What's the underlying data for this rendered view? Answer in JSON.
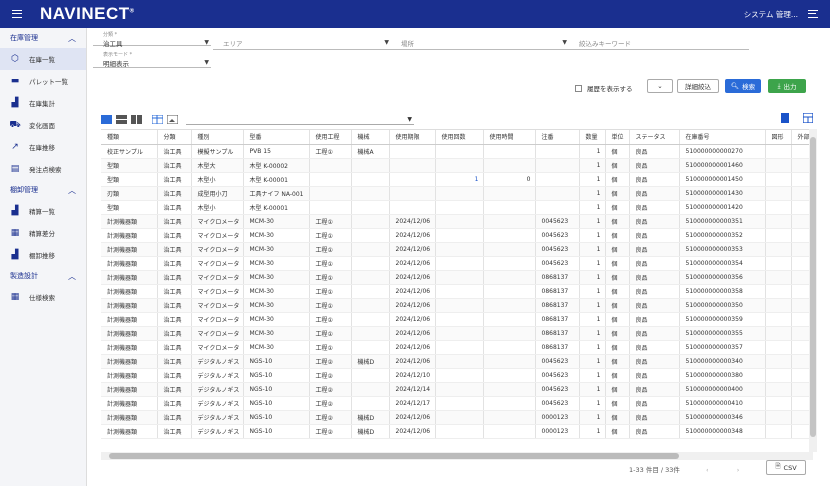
{
  "app": {
    "logo": "NAVINECT",
    "logo_mark": "®",
    "system_menu": "システム 管理..."
  },
  "sidebar": {
    "sections": [
      {
        "label": "在庫管理",
        "items": [
          {
            "label": "在庫一覧",
            "icon": "cube-icon",
            "active": true
          },
          {
            "label": "パレット一覧",
            "icon": "pallet-icon",
            "active": false
          },
          {
            "label": "在庫集計",
            "icon": "bar-chart-icon",
            "active": false
          },
          {
            "label": "変化画面",
            "icon": "forklift-icon",
            "active": false
          },
          {
            "label": "在庫推移",
            "icon": "line-chart-icon",
            "active": false
          },
          {
            "label": "発注点検索",
            "icon": "clipboard-icon",
            "active": false
          }
        ]
      },
      {
        "label": "棚卸管理",
        "items": [
          {
            "label": "精算一覧",
            "icon": "bar-chart-icon",
            "active": false
          },
          {
            "label": "精算差分",
            "icon": "document-icon",
            "active": false
          },
          {
            "label": "棚卸推移",
            "icon": "bar-chart-icon",
            "active": false
          }
        ]
      },
      {
        "label": "製造設計",
        "items": [
          {
            "label": "仕様検索",
            "icon": "document-icon",
            "active": false
          }
        ]
      }
    ]
  },
  "filters": {
    "bunrui_label": "分類 *",
    "bunrui_value": "治工具",
    "area_placeholder": "エリア",
    "basho_placeholder": "場所",
    "keyword_placeholder": "絞込みキーワード",
    "mode_label": "表示モード *",
    "mode_value": "明細表示",
    "show_history": "履歴を表示する",
    "btn_narrow": "詳細絞込",
    "btn_search": "検索",
    "btn_output": "出力"
  },
  "table": {
    "columns": [
      "種類",
      "分類",
      "種別",
      "型番",
      "使用工程",
      "機械",
      "使用期限",
      "使用回数",
      "使用時間",
      "注番",
      "数量",
      "単位",
      "ステータス",
      "在庫番号",
      "図形",
      "外部"
    ],
    "rows": [
      [
        "校正サンプル",
        "治工具",
        "模擬サンプル",
        "PVB 15",
        "工程①",
        "機械A",
        "",
        "",
        "",
        "",
        "1",
        "個",
        "良品",
        "510000000000270",
        "",
        ""
      ],
      [
        "型類",
        "治工具",
        "木型大",
        "木型 K-00002",
        "",
        "",
        "",
        "",
        "",
        "",
        "1",
        "個",
        "良品",
        "510000000001460",
        "",
        ""
      ],
      [
        "型類",
        "治工具",
        "木型小",
        "木型 K-00001",
        "",
        "",
        "",
        "1",
        "0",
        "",
        "1",
        "個",
        "良品",
        "510000000001450",
        "",
        ""
      ],
      [
        "刃類",
        "治工具",
        "成型用小刀",
        "工具ナイフ NA-001",
        "",
        "",
        "",
        "",
        "",
        "",
        "1",
        "個",
        "良品",
        "510000000001430",
        "",
        ""
      ],
      [
        "型類",
        "治工具",
        "木型小",
        "木型 K-00001",
        "",
        "",
        "",
        "",
        "",
        "",
        "1",
        "個",
        "良品",
        "510000000001420",
        "",
        ""
      ],
      [
        "計測機器類",
        "治工具",
        "マイクロメータ",
        "MCM-30",
        "工程①",
        "",
        "2024/12/06",
        "",
        "",
        "0045623",
        "1",
        "個",
        "良品",
        "510000000000351",
        "",
        ""
      ],
      [
        "計測機器類",
        "治工具",
        "マイクロメータ",
        "MCM-30",
        "工程①",
        "",
        "2024/12/06",
        "",
        "",
        "0045623",
        "1",
        "個",
        "良品",
        "510000000000352",
        "",
        ""
      ],
      [
        "計測機器類",
        "治工具",
        "マイクロメータ",
        "MCM-30",
        "工程①",
        "",
        "2024/12/06",
        "",
        "",
        "0045623",
        "1",
        "個",
        "良品",
        "510000000000353",
        "",
        ""
      ],
      [
        "計測機器類",
        "治工具",
        "マイクロメータ",
        "MCM-30",
        "工程①",
        "",
        "2024/12/06",
        "",
        "",
        "0045623",
        "1",
        "個",
        "良品",
        "510000000000354",
        "",
        ""
      ],
      [
        "計測機器類",
        "治工具",
        "マイクロメータ",
        "MCM-30",
        "工程①",
        "",
        "2024/12/06",
        "",
        "",
        "0868137",
        "1",
        "個",
        "良品",
        "510000000000356",
        "",
        ""
      ],
      [
        "計測機器類",
        "治工具",
        "マイクロメータ",
        "MCM-30",
        "工程①",
        "",
        "2024/12/06",
        "",
        "",
        "0868137",
        "1",
        "個",
        "良品",
        "510000000000358",
        "",
        ""
      ],
      [
        "計測機器類",
        "治工具",
        "マイクロメータ",
        "MCM-30",
        "工程①",
        "",
        "2024/12/06",
        "",
        "",
        "0868137",
        "1",
        "個",
        "良品",
        "510000000000350",
        "",
        ""
      ],
      [
        "計測機器類",
        "治工具",
        "マイクロメータ",
        "MCM-30",
        "工程①",
        "",
        "2024/12/06",
        "",
        "",
        "0868137",
        "1",
        "個",
        "良品",
        "510000000000359",
        "",
        ""
      ],
      [
        "計測機器類",
        "治工具",
        "マイクロメータ",
        "MCM-30",
        "工程①",
        "",
        "2024/12/06",
        "",
        "",
        "0868137",
        "1",
        "個",
        "良品",
        "510000000000355",
        "",
        ""
      ],
      [
        "計測機器類",
        "治工具",
        "マイクロメータ",
        "MCM-30",
        "工程①",
        "",
        "2024/12/06",
        "",
        "",
        "0868137",
        "1",
        "個",
        "良品",
        "510000000000357",
        "",
        ""
      ],
      [
        "計測機器類",
        "治工具",
        "デジタルノギス",
        "NGS-10",
        "工程②",
        "機械D",
        "2024/12/06",
        "",
        "",
        "0045623",
        "1",
        "個",
        "良品",
        "510000000000340",
        "",
        ""
      ],
      [
        "計測機器類",
        "治工具",
        "デジタルノギス",
        "NGS-10",
        "工程②",
        "",
        "2024/12/10",
        "",
        "",
        "0045623",
        "1",
        "個",
        "良品",
        "510000000000380",
        "",
        ""
      ],
      [
        "計測機器類",
        "治工具",
        "デジタルノギス",
        "NGS-10",
        "工程②",
        "",
        "2024/12/14",
        "",
        "",
        "0045623",
        "1",
        "個",
        "良品",
        "510000000000400",
        "",
        ""
      ],
      [
        "計測機器類",
        "治工具",
        "デジタルノギス",
        "NGS-10",
        "工程②",
        "",
        "2024/12/17",
        "",
        "",
        "0045623",
        "1",
        "個",
        "良品",
        "510000000000410",
        "",
        ""
      ],
      [
        "計測機器類",
        "治工具",
        "デジタルノギス",
        "NGS-10",
        "工程②",
        "機械D",
        "2024/12/06",
        "",
        "",
        "0000123",
        "1",
        "個",
        "良品",
        "510000000000346",
        "",
        ""
      ],
      [
        "計測機器類",
        "治工具",
        "デジタルノギス",
        "NGS-10",
        "工程②",
        "機械D",
        "2024/12/06",
        "",
        "",
        "0000123",
        "1",
        "個",
        "良品",
        "510000000000348",
        "",
        ""
      ]
    ]
  },
  "footer": {
    "pagination": "1-33 件目 / 33件",
    "csv": "CSV"
  }
}
